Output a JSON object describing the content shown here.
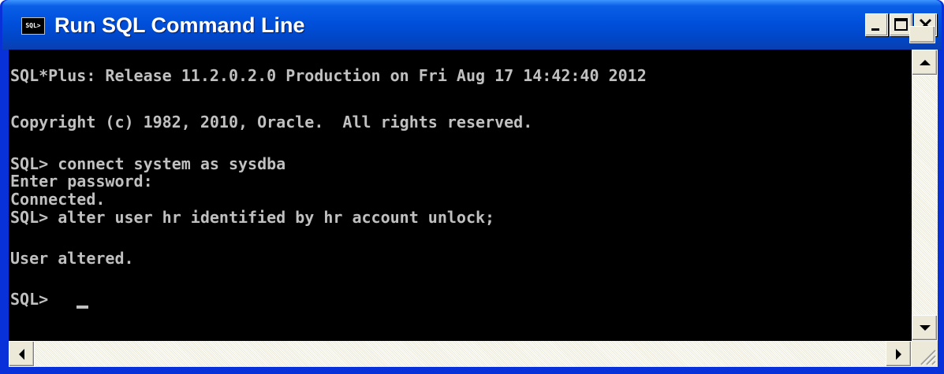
{
  "window": {
    "title": "Run SQL Command Line",
    "icon_label": "SQL>",
    "icons": {
      "app": "sql-console-icon",
      "minimize": "minimize-icon",
      "maximize": "maximize-icon",
      "close": "close-icon",
      "scroll_up": "arrow-up-icon",
      "scroll_down": "arrow-down-icon",
      "scroll_left": "arrow-left-icon",
      "scroll_right": "arrow-right-icon",
      "resize": "resize-grip-icon"
    }
  },
  "console": {
    "lines": [
      "SQL*Plus: Release 11.2.0.2.0 Production on Fri Aug 17 14:42:40 2012",
      "Copyright (c) 1982, 2010, Oracle.  All rights reserved.",
      "SQL> connect system as sysdba",
      "Enter password:",
      "Connected.",
      "SQL> alter user hr identified by hr account unlock;",
      "User altered.",
      "SQL> "
    ]
  },
  "colors": {
    "console_background": "#000000",
    "console_text": "#c0c0c0",
    "titlebar": "#0050dc",
    "frame": "#0831d9"
  }
}
